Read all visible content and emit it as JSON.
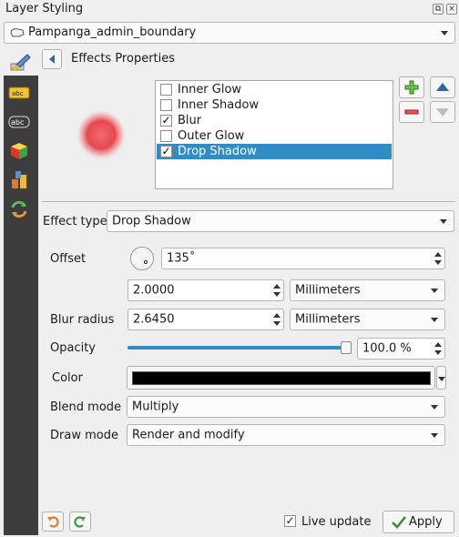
{
  "window": {
    "title": "Layer Styling"
  },
  "layer_select": {
    "value": "Pampanga_admin_boundary",
    "icon": "polygon-layer-icon"
  },
  "effects": {
    "header": "Effects Properties",
    "list": [
      {
        "label": "Inner Glow",
        "checked": false,
        "selected": false
      },
      {
        "label": "Inner Shadow",
        "checked": false,
        "selected": false
      },
      {
        "label": "Blur",
        "checked": true,
        "selected": false
      },
      {
        "label": "Outer Glow",
        "checked": false,
        "selected": false
      },
      {
        "label": "Drop Shadow",
        "checked": true,
        "selected": true
      }
    ],
    "check_mark": "✓"
  },
  "form": {
    "effect_type_label": "Effect type",
    "effect_type_value": "Drop Shadow",
    "offset_label": "Offset",
    "angle_value": "135˚",
    "offset_distance": "2.0000",
    "offset_unit": "Millimeters",
    "blur_radius_label": "Blur radius",
    "blur_radius_value": "2.6450",
    "blur_unit": "Millimeters",
    "opacity_label": "Opacity",
    "opacity_value": "100.0 %",
    "opacity_level": 1.0,
    "color_label": "Color",
    "color_value": "#000000",
    "blend_mode_label": "Blend mode",
    "blend_mode_value": "Multiply",
    "draw_mode_label": "Draw mode",
    "draw_mode_value": "Render and modify"
  },
  "footer": {
    "live_update_label": "Live update",
    "live_update_checked": true,
    "apply_label": "Apply"
  },
  "colors": {
    "selection": "#308cc6",
    "sidebar": "#3d3d3d",
    "preview": "#e8474f"
  }
}
